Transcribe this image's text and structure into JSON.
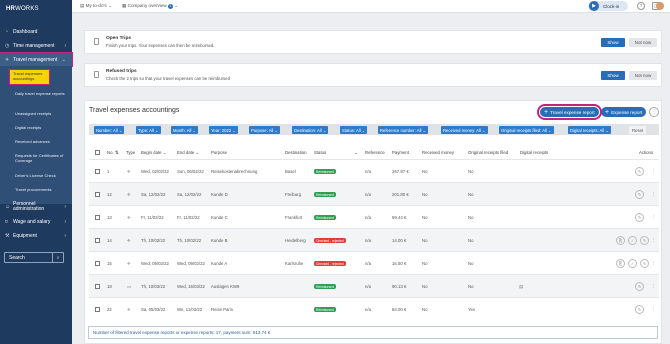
{
  "app": {
    "logo_bold": "HR",
    "logo_rest": "WORKS"
  },
  "sidebar": {
    "items": [
      {
        "label": "Dashboard",
        "icon": "gauge-icon"
      },
      {
        "label": "Time management",
        "icon": "clock-icon"
      },
      {
        "label": "Travel management",
        "icon": "plane-icon"
      }
    ],
    "subitems": [
      "Travel expenses accountings",
      "Daily travel expense reports",
      "Unassigned receipts",
      "Digital receipts",
      "Received advances",
      "Requests for Certificates of Coverage",
      "Driver's License Check",
      "Travel procurements"
    ],
    "items_bottom": [
      {
        "label": "Personnel administration",
        "icon": "people-icon"
      },
      {
        "label": "Wage and salary",
        "icon": "money-icon"
      },
      {
        "label": "Equipment",
        "icon": "tools-icon"
      }
    ],
    "search_placeholder": "Search"
  },
  "topbar": {
    "todo": "My to-do's",
    "company": "Company overview",
    "company_count": "1",
    "clock_in": "Clock-in"
  },
  "open_trips": {
    "title": "Open Trips",
    "desc": "Finish your trips. Your expenses can then be reimbursed.",
    "show": "Show",
    "not_now": "Not now"
  },
  "refused_trips": {
    "title": "Refused trips",
    "desc": "Check the 2 trips so that your travel expenses can be reimbursed",
    "show": "Show",
    "not_now": "Not now"
  },
  "main": {
    "title": "Travel expenses accountings",
    "btn_travel": "Travel expense report",
    "btn_expense": "Expense report",
    "reset": "Reset",
    "filters": [
      "Number: All",
      "Type: All",
      "Month: All",
      "Year: 2022",
      "Purpose: All",
      "Destination: All",
      "Status: All",
      "Reference number: All",
      "Received money: All",
      "Original receipts filed: All",
      "Digital receipts: All"
    ],
    "headers": [
      "No.",
      "Type",
      "Begin date",
      "End date",
      "Purpose",
      "Destination",
      "Status",
      "Reference",
      "Payment",
      "Received money",
      "Original receipts filed",
      "Digital receipts",
      "Actions"
    ],
    "rows": [
      {
        "no": "1",
        "type": "travel",
        "begin": "Wed, 02/02/22",
        "end": "Sun, 06/02/22",
        "purpose": "Reisekostenabrechnung",
        "dest": "Basel",
        "status": "Reimbursed",
        "st": "g",
        "ref": "n/a",
        "pay": "267.87 €",
        "recv": "No",
        "orig": "No",
        "digital": ""
      },
      {
        "no": "12",
        "type": "travel",
        "begin": "Sa, 12/02/22",
        "end": "Sa, 12/02/22",
        "purpose": "Kunde D",
        "dest": "Freiburg",
        "status": "Reimbursed",
        "st": "g",
        "ref": "n/a",
        "pay": "201.80 €",
        "recv": "No",
        "orig": "No",
        "digital": ""
      },
      {
        "no": "13",
        "type": "travel",
        "begin": "Fr, 11/02/22",
        "end": "Fr, 11/02/22",
        "purpose": "Kunde C",
        "dest": "Frankfurt",
        "status": "Reimbursed",
        "st": "g",
        "ref": "n/a",
        "pay": "59.44 €",
        "recv": "No",
        "orig": "No",
        "digital": ""
      },
      {
        "no": "14",
        "type": "travel",
        "begin": "Th, 10/02/22",
        "end": "Th, 10/02/22",
        "purpose": "Kunde B",
        "dest": "Heidelberg",
        "status": "Checked - rejected",
        "st": "r",
        "ref": "n/a",
        "pay": "14.00 €",
        "recv": "No",
        "orig": "No",
        "digital": ""
      },
      {
        "no": "15",
        "type": "travel",
        "begin": "Wed, 09/02/22",
        "end": "Wed, 09/02/22",
        "purpose": "Kunde A",
        "dest": "Karlsruhe",
        "status": "Checked - rejected",
        "st": "r",
        "ref": "n/a",
        "pay": "16.50 €",
        "recv": "No",
        "orig": "No",
        "digital": ""
      },
      {
        "no": "18",
        "type": "expense",
        "begin": "Th, 10/03/22",
        "end": "Wed, 16/03/22",
        "purpose": "Auslagen KW9",
        "dest": "",
        "status": "Reimbursed",
        "st": "g",
        "ref": "n/a",
        "pay": "90.13 €",
        "recv": "No",
        "orig": "No",
        "digital": "doc"
      },
      {
        "no": "22",
        "type": "travel",
        "begin": "Sa, 05/03/22",
        "end": "We, 11/03/22",
        "purpose": "Reise Paris",
        "dest": "",
        "status": "Reimbursed",
        "st": "g",
        "ref": "n/a",
        "pay": "84.00 €",
        "recv": "No",
        "orig": "Yes",
        "digital": ""
      }
    ],
    "footer": "Number of filtered travel expense reports or expense reports: 17, payment sum: 913.74 €"
  },
  "colors": {
    "sidebar": "#1f3a5f",
    "accent": "#2a6db6",
    "highlight": "#c8217c",
    "selected": "#f5d400",
    "reimbursed": "#2f9e55",
    "rejected": "#e03c3c"
  }
}
